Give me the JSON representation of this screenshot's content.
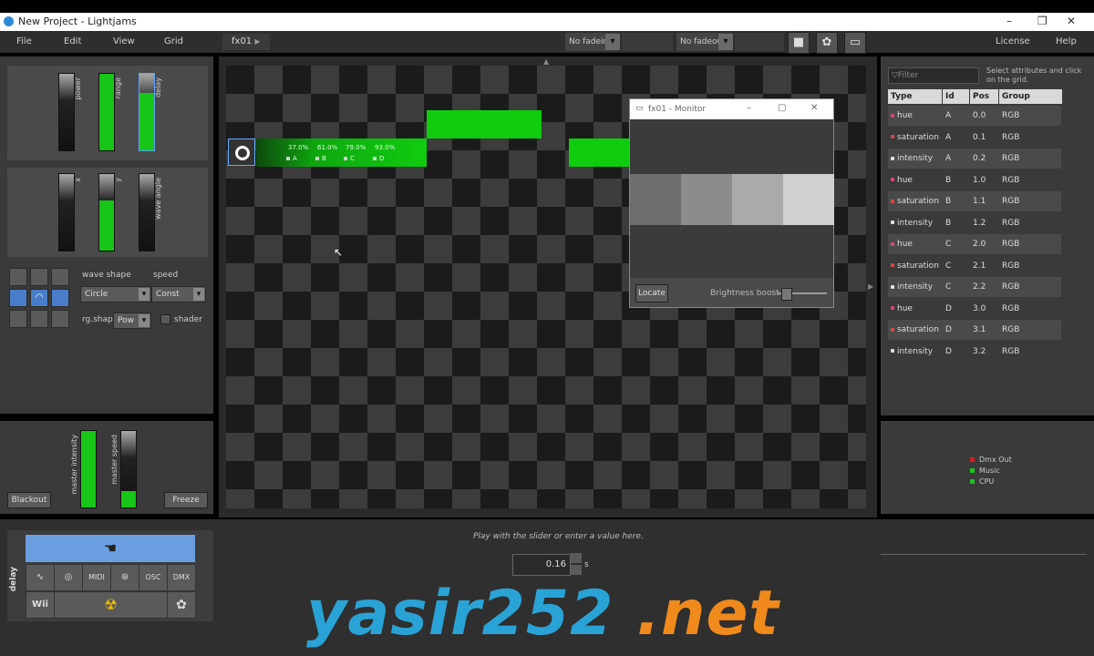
{
  "window": {
    "title": "New Project - Lightjams",
    "min": "–",
    "max": "❐",
    "close": "✕"
  },
  "menu": [
    "File",
    "Edit",
    "View",
    "Grid"
  ],
  "menu_right": [
    "License",
    "Help"
  ],
  "grid_tab": "fx01",
  "toolbar": {
    "fade_in": "No fadein",
    "fade_out": "No fadeout"
  },
  "left_panel": {
    "top_sliders": [
      {
        "label": "power",
        "level": 0.0
      },
      {
        "label": "range",
        "level": 1.0
      },
      {
        "label": "delay",
        "level": 0.75
      }
    ],
    "mid_sliders": [
      {
        "label": "x",
        "level": 0.0
      },
      {
        "label": "y",
        "level": 0.65
      },
      {
        "label": "wave angle",
        "level": 0.0
      }
    ],
    "wave_shape_label": "wave shape",
    "speed_label": "speed",
    "wave_shape_value": "Circle",
    "speed_value": "Const",
    "rg_shape_label": "rg.shape",
    "rg_shape_value": "Pow",
    "shader_label": "shader"
  },
  "master": {
    "sliders": [
      {
        "label": "master intensity",
        "level": 1.0
      },
      {
        "label": "master speed",
        "level": 0.25
      }
    ],
    "blackout": "Blackout",
    "freeze": "Freeze"
  },
  "grid_cells": {
    "percents": [
      "37.0%",
      "61.0%",
      "79.0%",
      "93.0%"
    ],
    "channels": [
      "A",
      "B",
      "C",
      "D"
    ]
  },
  "monitor": {
    "title": "fx01 - Monitor",
    "locate": "Locate",
    "brightness_label": "Brightness boost",
    "brightness_level": 0.1,
    "gray_swatches": [
      "#6e6e6e",
      "#8c8c8c",
      "#aaaaaa",
      "#d0d0d0"
    ]
  },
  "right_panel": {
    "filter_placeholder": "Filter",
    "hint": "Select attributes and click on the grid.",
    "columns": [
      "Type",
      "Id",
      "Pos",
      "Group"
    ],
    "rows": [
      {
        "type": "hue",
        "id": "A",
        "pos": "0.0",
        "group": "RGB",
        "color": "#e0457a"
      },
      {
        "type": "saturation",
        "id": "A",
        "pos": "0.1",
        "group": "RGB",
        "color": "#e04545"
      },
      {
        "type": "intensity",
        "id": "A",
        "pos": "0.2",
        "group": "RGB",
        "color": "#e0e0e0"
      },
      {
        "type": "hue",
        "id": "B",
        "pos": "1.0",
        "group": "RGB",
        "color": "#e0457a"
      },
      {
        "type": "saturation",
        "id": "B",
        "pos": "1.1",
        "group": "RGB",
        "color": "#e04545"
      },
      {
        "type": "intensity",
        "id": "B",
        "pos": "1.2",
        "group": "RGB",
        "color": "#e0e0e0"
      },
      {
        "type": "hue",
        "id": "C",
        "pos": "2.0",
        "group": "RGB",
        "color": "#e0457a"
      },
      {
        "type": "saturation",
        "id": "C",
        "pos": "2.1",
        "group": "RGB",
        "color": "#e04545"
      },
      {
        "type": "intensity",
        "id": "C",
        "pos": "2.2",
        "group": "RGB",
        "color": "#e0e0e0"
      },
      {
        "type": "hue",
        "id": "D",
        "pos": "3.0",
        "group": "RGB",
        "color": "#e0457a"
      },
      {
        "type": "saturation",
        "id": "D",
        "pos": "3.1",
        "group": "RGB",
        "color": "#e04545"
      },
      {
        "type": "intensity",
        "id": "D",
        "pos": "3.2",
        "group": "RGB",
        "color": "#e0e0e0"
      }
    ],
    "legend": [
      {
        "label": "Dmx Out",
        "color": "#d02020"
      },
      {
        "label": "Music",
        "color": "#20c020"
      },
      {
        "label": "CPU",
        "color": "#20c020"
      }
    ]
  },
  "bottom": {
    "delay_label": "delay",
    "tiles": [
      "∿",
      "◎",
      "MIDI",
      "⊛",
      "OSC",
      "DMX"
    ],
    "wii": "Wii",
    "hint": "Play with the slider or enter a value here.",
    "value": "0.16",
    "unit": "s"
  },
  "watermark": {
    "part1": "yasir252",
    "part2": " .net",
    "color1": "#29a3d6",
    "color2": "#f08a1c"
  }
}
